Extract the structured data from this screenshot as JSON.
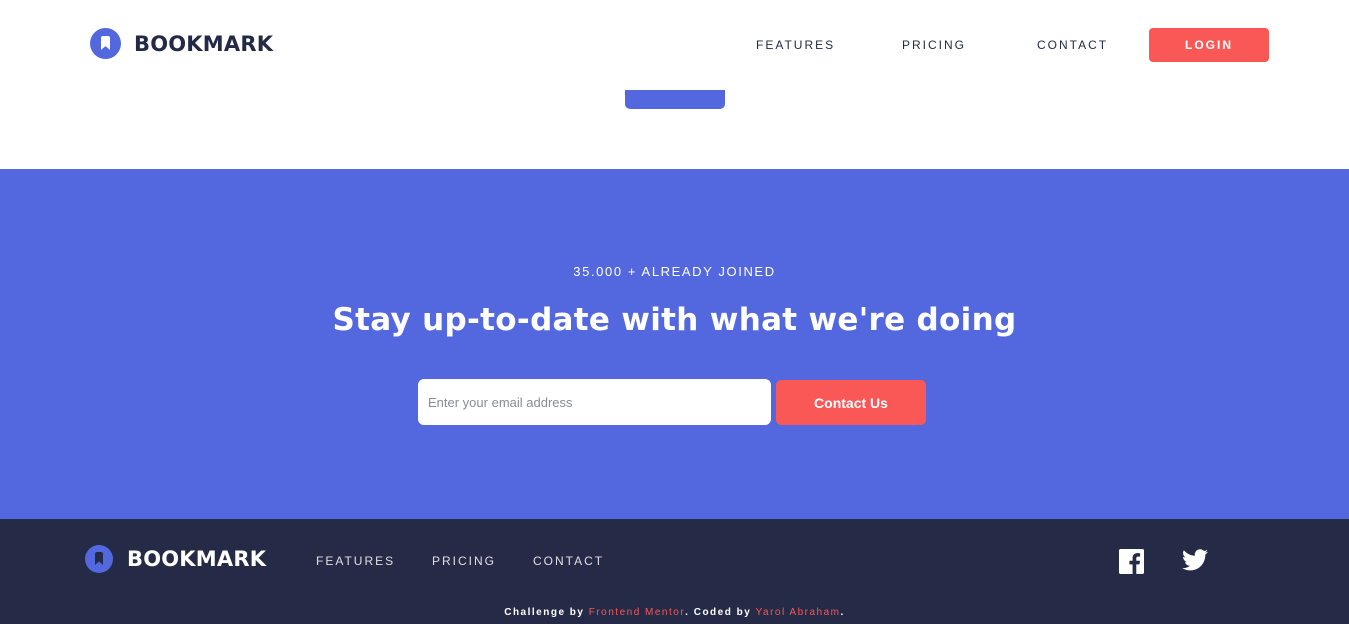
{
  "colors": {
    "primary": "#5368DF",
    "accent": "#FA5757",
    "dark": "#242A45",
    "footer_bg": "#252B46"
  },
  "header": {
    "brand": "BOOKMARK",
    "nav": {
      "features": "FEATURES",
      "pricing": "PRICING",
      "contact": "CONTACT"
    },
    "login_label": "LOGIN"
  },
  "cta": {
    "eyebrow": "35.000 + ALREADY JOINED",
    "title": "Stay up-to-date with what we're doing",
    "email_placeholder": "Enter your email address",
    "button_label": "Contact Us"
  },
  "footer": {
    "brand": "BOOKMARK",
    "nav": {
      "features": "FEATURES",
      "pricing": "PRICING",
      "contact": "CONTACT"
    },
    "social": [
      "facebook-icon",
      "twitter-icon"
    ],
    "credits": {
      "prefix": "Challenge by ",
      "challenge_link": "Frontend Mentor",
      "middle": ". Coded by ",
      "author_link": "Yarol Abraham",
      "suffix": "."
    }
  }
}
